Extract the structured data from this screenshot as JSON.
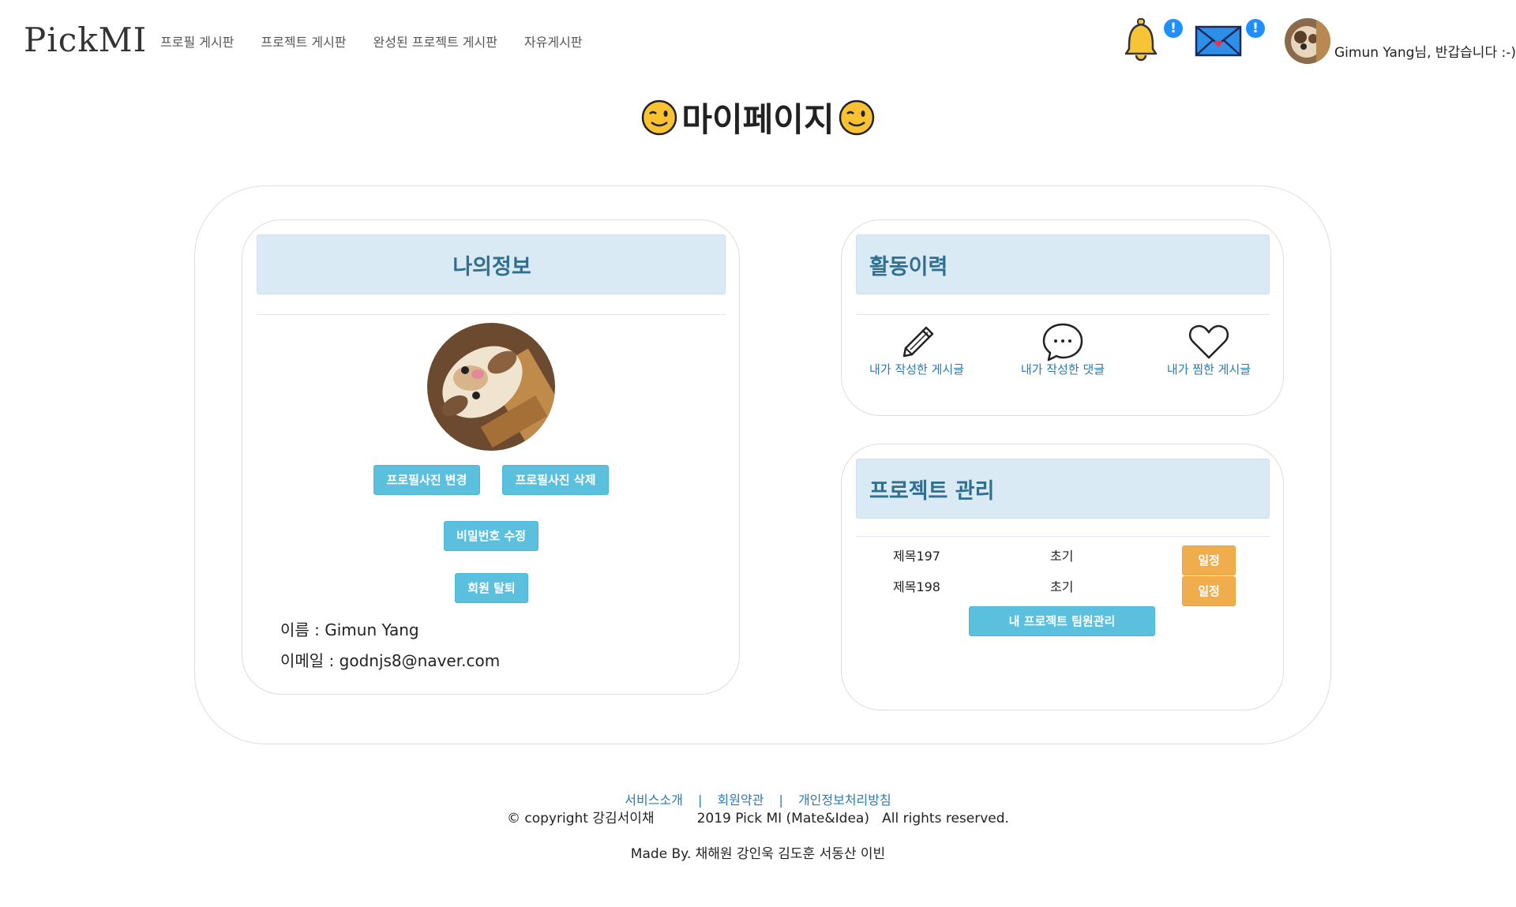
{
  "nav": {
    "logo": "PickMI",
    "menu": [
      "프로필 게시판",
      "프로젝트 게시판",
      "완성된 프로젝트 게시판",
      "자유게시판"
    ],
    "notification_badge": "!",
    "message_badge": "!",
    "greeting": "Gimun Yang님, 반갑습니다 :-)"
  },
  "page_title": "마이페이지",
  "my_info": {
    "title": "나의정보",
    "change_photo": "프로필사진 변경",
    "delete_photo": "프로필사진 삭제",
    "change_password": "비밀번호 수정",
    "withdraw": "회원 탈퇴",
    "name_line": "이름 : Gimun Yang",
    "email_line": "이메일 : godnjs8@naver.com"
  },
  "activity": {
    "title": "활동이력",
    "items": [
      {
        "label": "내가 작성한 게시글",
        "icon": "pencil-icon"
      },
      {
        "label": "내가 작성한 댓글",
        "icon": "speech-bubble-icon"
      },
      {
        "label": "내가 찜한 게시글",
        "icon": "heart-icon"
      }
    ]
  },
  "projects": {
    "title": "프로젝트 관리",
    "rows": [
      {
        "name": "제목197",
        "stage": "초기",
        "action": "일정"
      },
      {
        "name": "제목198",
        "stage": "초기",
        "action": "일정"
      }
    ],
    "manage_button": "내 프로젝트 팀원관리"
  },
  "footer": {
    "links": [
      "서비스소개",
      "회원약관",
      "개인정보처리방침"
    ],
    "separator": "|",
    "copyright": "© copyright 강김서이채          2019 Pick MI (Mate&Idea)   All rights reserved.",
    "made_by": "Made By. 채해원 강인욱 김도훈 서동산 이빈"
  },
  "colors": {
    "accent_button": "#5bc0de",
    "warning_button": "#f0ad4e",
    "card_header_bg": "#daeaf4",
    "link": "#2a7ab0",
    "badge": "#1e90ff"
  }
}
